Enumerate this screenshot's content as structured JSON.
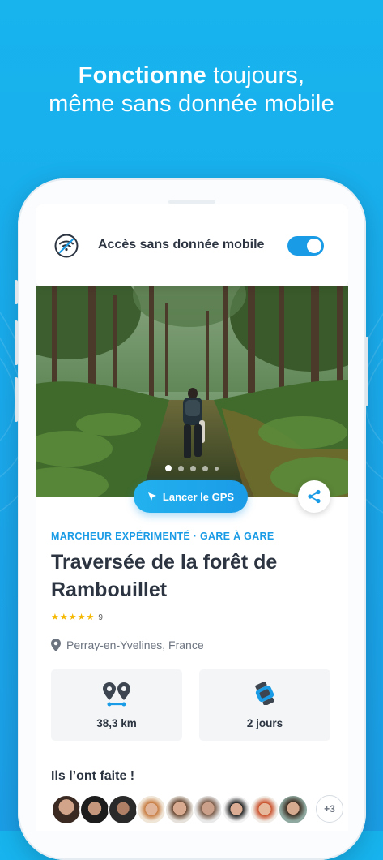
{
  "headline": {
    "bold": "Fonctionne",
    "rest_line1": " toujours,",
    "line2": "même sans donnée mobile"
  },
  "offline_card": {
    "icon": "wifi-off-icon",
    "label": "Accès sans donnée mobile",
    "toggle_on": true,
    "accent": "#1a9be6"
  },
  "gallery": {
    "slide_count": 5,
    "active_index": 0
  },
  "actions": {
    "gps_label": "Lancer le GPS",
    "gps_icon": "cursor-arrow-icon",
    "share_icon": "share-icon"
  },
  "hike": {
    "category": "MARCHEUR EXPÉRIMENTÉ · GARE À GARE",
    "title": "Traversée de la forêt de Rambouillet",
    "rating_stars": 5,
    "rating_count": "9",
    "location": "Perray-en-Yvelines, France"
  },
  "stats": [
    {
      "icon": "distance-pins-icon",
      "value": "38,3 km"
    },
    {
      "icon": "duration-icon",
      "value": "2 jours"
    }
  ],
  "completed": {
    "title": "Ils l’ont faite !",
    "more": "+3"
  },
  "colors": {
    "background": "#1aa7ea",
    "accent": "#1a9be6",
    "text": "#2b3440",
    "star": "#f5b800"
  }
}
